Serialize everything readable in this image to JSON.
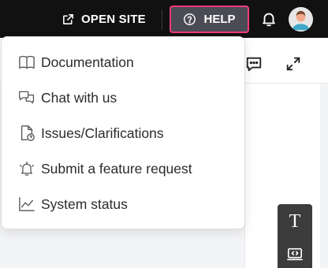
{
  "topbar": {
    "open_site_label": "OPEN SITE",
    "help_label": "HELP",
    "accent_color": "#ef3b7c"
  },
  "help_menu": {
    "items": [
      {
        "label": "Documentation",
        "icon": "book-icon"
      },
      {
        "label": "Chat with us",
        "icon": "chat-bubbles-icon"
      },
      {
        "label": "Issues/Clarifications",
        "icon": "file-question-icon"
      },
      {
        "label": "Submit a feature request",
        "icon": "bell-ring-icon"
      },
      {
        "label": "System status",
        "icon": "line-chart-icon"
      }
    ]
  },
  "side_tools": {
    "text_tool_glyph": "T"
  }
}
